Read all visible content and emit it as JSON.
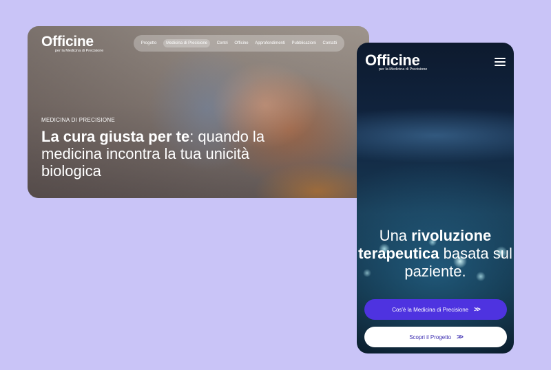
{
  "desktop": {
    "logo": {
      "word": "Officine",
      "tagline": "per la Medicina di Precisione"
    },
    "nav": [
      {
        "label": "Progetto"
      },
      {
        "label": "Medicina di Precisione",
        "active": true
      },
      {
        "label": "Centri"
      },
      {
        "label": "Officine"
      },
      {
        "label": "Approfondimenti"
      },
      {
        "label": "Pubblicazioni"
      },
      {
        "label": "Contatti"
      }
    ],
    "eyebrow": "MEDICINA DI PRECISIONE",
    "headline_bold": "La cura giusta per te",
    "headline_rest": ": quando la medicina incontra la tua unicità biologica"
  },
  "mobile": {
    "logo": {
      "word": "Officine",
      "tagline": "per la Medicina di Precisione"
    },
    "menu_icon": "hamburger-icon",
    "headline_pre": "Una ",
    "headline_bold1": "rivoluzione terapeutica",
    "headline_post": " basata sul paziente.",
    "primary_button": "Cos'è la Medicina di Precisione",
    "secondary_button": "Scopri il Progetto",
    "button_icon": "double-chevron-right-icon",
    "colors": {
      "primary": "#4e33e0",
      "secondary_text": "#3a2bb0"
    }
  },
  "colors": {
    "background": "#c9c4f7"
  }
}
